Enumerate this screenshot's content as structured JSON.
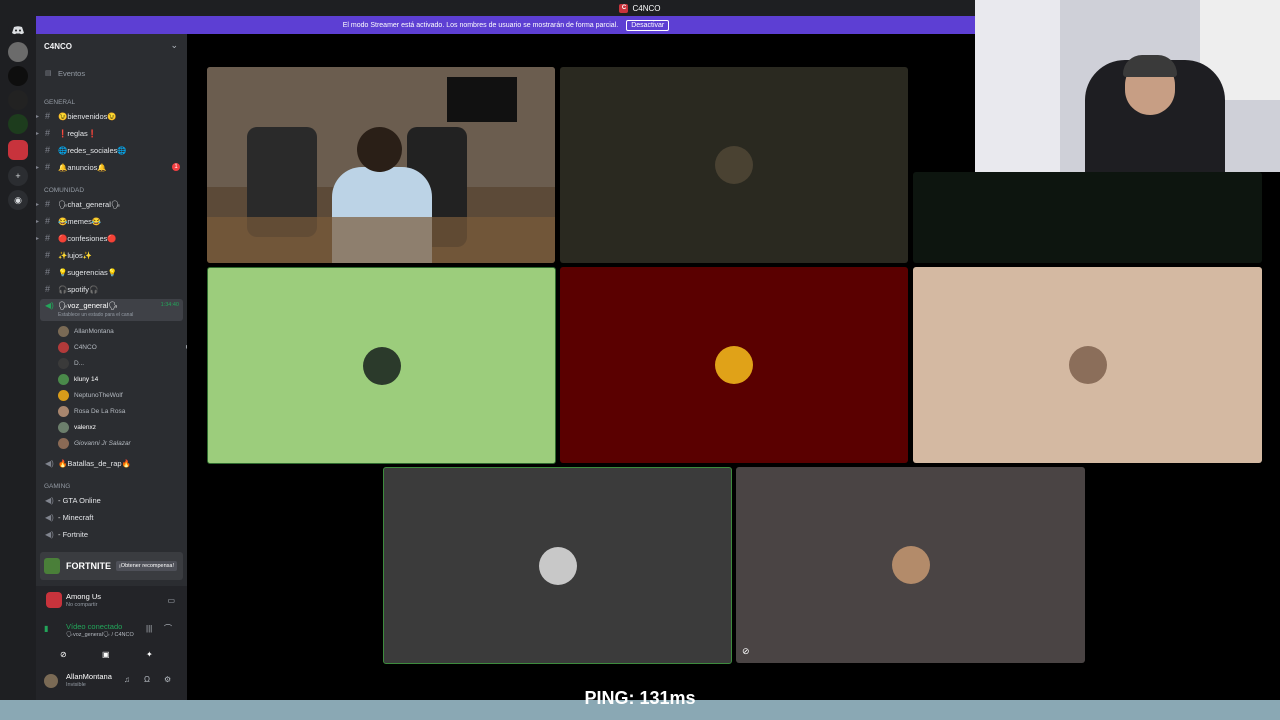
{
  "titlebar": {
    "app_name": "C4NCO"
  },
  "banner": {
    "text": "El modo Streamer está activado. Los nombres de usuario se mostrarán de forma parcial.",
    "button": "Desactivar"
  },
  "server": {
    "name": "C4NCO",
    "events_label": "Eventos",
    "categories": {
      "general": "GENERAL",
      "comunidad": "COMUNIDAD",
      "gaming": "GAMING"
    },
    "channels_general": [
      {
        "label": "😉bienvenidos😉"
      },
      {
        "label": "❗reglas❗"
      },
      {
        "label": "🌐redes_sociales🌐"
      },
      {
        "label": "🔔anuncios🔔",
        "badge": "1"
      }
    ],
    "channels_comunidad": [
      {
        "label": "🗣chat_general🗣"
      },
      {
        "label": "😂memes😂"
      },
      {
        "label": "🔴confesiones🔴"
      },
      {
        "label": "✨lujos✨"
      },
      {
        "label": "💡sugerencias💡"
      },
      {
        "label": "🎧spotify🎧"
      }
    ],
    "voice_general": {
      "label": "🗣voz_general🗣",
      "timer": "1:34:40",
      "status": "Establece un estado para el canal"
    },
    "voice_users": [
      {
        "name": "AllanMontana",
        "color": "#7a6a55"
      },
      {
        "name": "C4NCO",
        "color": "#b23a3a"
      },
      {
        "name": "D...",
        "color": "#3a3a3a"
      },
      {
        "name": "kluny 14",
        "color": "#4a8a4a"
      },
      {
        "name": "NeptunoTheWolf",
        "color": "#d89c1a"
      },
      {
        "name": "Rosa De La Rosa",
        "color": "#a8866e"
      },
      {
        "name": "valenxz",
        "color": "#6c7f6c"
      },
      {
        "name": "Giovanni Jr Salazar",
        "color": "#8a6a55"
      }
    ],
    "voice_other": {
      "label": "🔥Batallas_de_rap🔥"
    },
    "channels_gaming": [
      {
        "label": "- GTA Online"
      },
      {
        "label": "- Minecraft"
      },
      {
        "label": "- Fortnite"
      }
    ]
  },
  "promo": {
    "title": "FORTNITE",
    "button": "¡Obtener recompensa!"
  },
  "activity": {
    "game": "Among Us",
    "status": "No compartir"
  },
  "voice_status": {
    "title": "Vídeo conectado",
    "channel": "🗣voz_general🗣 / C4NCO"
  },
  "user": {
    "name": "AllanMontana",
    "status": "Invisible"
  },
  "bottom_overlay": {
    "text": "PING: 131ms"
  }
}
